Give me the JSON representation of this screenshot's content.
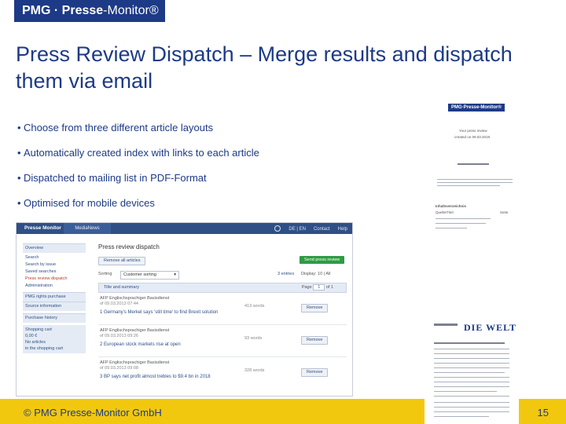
{
  "logo": {
    "bold": "PMG · Presse",
    "thin": "-Monitor®"
  },
  "title": "Press Review Dispatch – Merge results and dispatch them via email",
  "bullets": [
    "Choose from three different article layouts",
    "Automatically created index with links to each article",
    "Dispatched to mailing list in PDF-Format",
    "Optimised for mobile devices"
  ],
  "app": {
    "brand": "Presse Monitor",
    "tab": "MediaNews",
    "nav_right": [
      "DE | EN",
      "Contact",
      "Help"
    ],
    "sidebar": {
      "items": [
        "Overview",
        "Search",
        "Search by issue",
        "Saved searches",
        "Press review dispatch",
        "Administration"
      ],
      "active_index": 4,
      "boxes": [
        "PMG rights purchase",
        "Source information",
        "Purchase history"
      ],
      "cart": [
        "Shopping cart",
        "0,00 €",
        "No articles",
        "in the shopping cart"
      ]
    },
    "heading": "Press review dispatch",
    "remove_all": "Remove all articles",
    "send": "Send press review",
    "sort_label": "Sorting",
    "sort_value": "Customer sorting",
    "results": "3 entries",
    "display_label": "Display: 10 | All",
    "bar_label": "Title and summary",
    "page_label": "Page",
    "page_value": "1",
    "page_of": "of 1",
    "articles": [
      {
        "source": "AFP Englischsprachiger Basisdienst",
        "date": "of 09.03.2013 07:44",
        "headline": "1 Germany's Merkel says 'still time' to find Brexit solution",
        "words": "413 words",
        "remove": "Remove"
      },
      {
        "source": "AFP Englischsprachiger Basisdienst",
        "date": "of 09.03.2013 09:26",
        "headline": "2 European stock markets rise at open",
        "words": "93 words",
        "remove": "Remove"
      },
      {
        "source": "AFP Englischsprachiger Basisdienst",
        "date": "of 09.03.2013 09:08",
        "headline": "3 BP says net profit almost trebles to $9.4 bn in 2018",
        "words": "328 words",
        "remove": "Remove"
      }
    ]
  },
  "thumb1": {
    "logo": "PMG·Presse-Monitor®",
    "heading": "Your press review",
    "sub": "created on 09.03.2019"
  },
  "thumb2": {
    "heading": "Inhaltsverzeichnis",
    "col1": "Quelle/Titel",
    "col2": "Seite"
  },
  "thumb3": {
    "welt": "DIE WELT"
  },
  "footer": {
    "copyright": "© PMG Presse-Monitor GmbH",
    "page": "15"
  },
  "colors": {
    "brand_blue": "#1d3a86",
    "footer_yellow": "#f2c80f",
    "button_green": "#2e9b44"
  }
}
